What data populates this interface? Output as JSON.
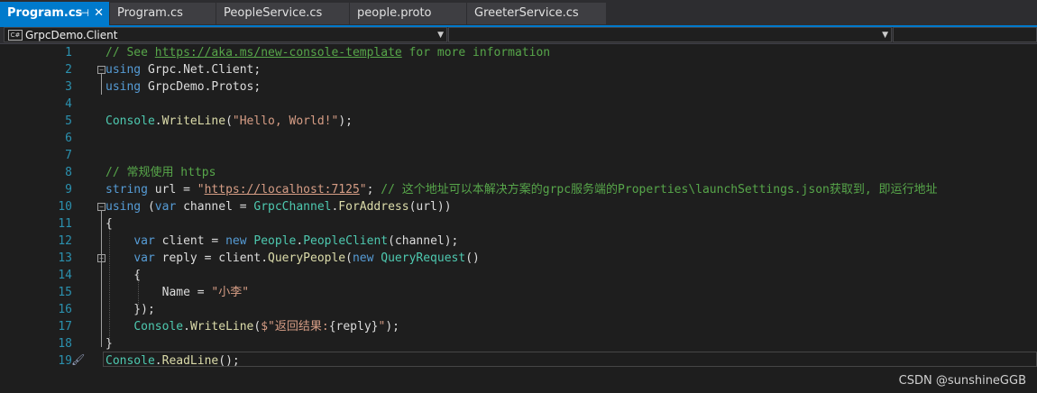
{
  "tabs": [
    {
      "label": "Program.cs",
      "active": true,
      "pin_icon": "pin-icon",
      "close_icon": "close-icon"
    },
    {
      "label": "Program.cs"
    },
    {
      "label": "PeopleService.cs"
    },
    {
      "label": "people.proto"
    },
    {
      "label": "GreeterService.cs"
    }
  ],
  "navigation": {
    "project": "GrpcDemo.Client",
    "project_icon": "csharp-project-icon",
    "type_combo": "",
    "member_combo": ""
  },
  "editor": {
    "current_line": 19,
    "lines": [
      {
        "n": "1",
        "tokens": [
          [
            "comment",
            "// See "
          ],
          [
            "link",
            "https://aka.ms/new-console-template"
          ],
          [
            "comment",
            " for more information"
          ]
        ]
      },
      {
        "n": "2",
        "tokens": [
          [
            "kw",
            "using"
          ],
          [
            "plain",
            " Grpc.Net.Client;"
          ]
        ]
      },
      {
        "n": "3",
        "tokens": [
          [
            "kw",
            "using"
          ],
          [
            "plain",
            " GrpcDemo.Protos;"
          ]
        ]
      },
      {
        "n": "4",
        "tokens": []
      },
      {
        "n": "5",
        "tokens": [
          [
            "type",
            "Console"
          ],
          [
            "plain",
            "."
          ],
          [
            "method",
            "WriteLine"
          ],
          [
            "plain",
            "("
          ],
          [
            "str",
            "\"Hello, World!\""
          ],
          [
            "plain",
            ");"
          ]
        ]
      },
      {
        "n": "6",
        "tokens": []
      },
      {
        "n": "7",
        "tokens": []
      },
      {
        "n": "8",
        "tokens": [
          [
            "comment",
            "// 常规使用 https"
          ]
        ]
      },
      {
        "n": "9",
        "tokens": [
          [
            "kw",
            "string"
          ],
          [
            "plain",
            " url = "
          ],
          [
            "str",
            "\""
          ],
          [
            "strlink",
            "https://localhost:7125"
          ],
          [
            "str",
            "\""
          ],
          [
            "plain",
            "; "
          ],
          [
            "comment",
            "// 这个地址可以本解决方案的grpc服务端的Properties\\launchSettings.json获取到, 即运行地址"
          ]
        ]
      },
      {
        "n": "10",
        "tokens": [
          [
            "kw",
            "using"
          ],
          [
            "plain",
            " ("
          ],
          [
            "kw",
            "var"
          ],
          [
            "plain",
            " channel = "
          ],
          [
            "type",
            "GrpcChannel"
          ],
          [
            "plain",
            "."
          ],
          [
            "method",
            "ForAddress"
          ],
          [
            "plain",
            "(url))"
          ]
        ]
      },
      {
        "n": "11",
        "tokens": [
          [
            "plain",
            "{"
          ]
        ]
      },
      {
        "n": "12",
        "tokens": [
          [
            "plain",
            "    "
          ],
          [
            "kw",
            "var"
          ],
          [
            "plain",
            " client = "
          ],
          [
            "kw",
            "new"
          ],
          [
            "plain",
            " "
          ],
          [
            "type",
            "People"
          ],
          [
            "plain",
            "."
          ],
          [
            "type",
            "PeopleClient"
          ],
          [
            "plain",
            "(channel);"
          ]
        ]
      },
      {
        "n": "13",
        "tokens": [
          [
            "plain",
            "    "
          ],
          [
            "kw",
            "var"
          ],
          [
            "plain",
            " reply = client."
          ],
          [
            "method",
            "QueryPeople"
          ],
          [
            "plain",
            "("
          ],
          [
            "kw",
            "new"
          ],
          [
            "plain",
            " "
          ],
          [
            "type",
            "QueryRequest"
          ],
          [
            "plain",
            "()"
          ]
        ]
      },
      {
        "n": "14",
        "tokens": [
          [
            "plain",
            "    {"
          ]
        ]
      },
      {
        "n": "15",
        "tokens": [
          [
            "plain",
            "        Name = "
          ],
          [
            "str",
            "\"小李\""
          ]
        ]
      },
      {
        "n": "16",
        "tokens": [
          [
            "plain",
            "    });"
          ]
        ]
      },
      {
        "n": "17",
        "tokens": [
          [
            "plain",
            "    "
          ],
          [
            "type",
            "Console"
          ],
          [
            "plain",
            "."
          ],
          [
            "method",
            "WriteLine"
          ],
          [
            "plain",
            "("
          ],
          [
            "str",
            "$\"返回结果:"
          ],
          [
            "plain",
            "{reply}"
          ],
          [
            "str",
            "\""
          ],
          [
            "plain",
            ");"
          ]
        ]
      },
      {
        "n": "18",
        "tokens": [
          [
            "plain",
            "}"
          ]
        ]
      },
      {
        "n": "19",
        "tokens": [
          [
            "type",
            "Console"
          ],
          [
            "plain",
            "."
          ],
          [
            "method",
            "ReadLine"
          ],
          [
            "plain",
            "();"
          ]
        ]
      }
    ]
  },
  "watermark": "CSDN @sunshineGGB",
  "colors": {
    "accent": "#007acc",
    "background": "#1e1e1e",
    "line_number": "#2b91af",
    "comment": "#57a64a",
    "keyword": "#569cd6",
    "type": "#4ec9b0",
    "string": "#d69d85",
    "method": "#dcdcaa"
  }
}
